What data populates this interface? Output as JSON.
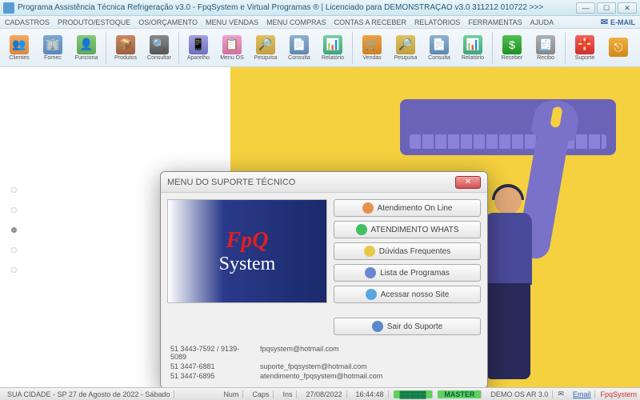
{
  "window": {
    "title": "Programa Assistência Técnica Refrigeração v3.0 - FpqSystem e Virtual Programas ® | Licenciado para  DEMONSTRAÇÃO v3.0 311212 010722 >>>",
    "min": "—",
    "max": "☐",
    "close": "✕"
  },
  "menubar": {
    "items": [
      "CADASTROS",
      "PRODUTO/ESTOQUE",
      "OS/ORÇAMENTO",
      "MENU VENDAS",
      "MENU COMPRAS",
      "CONTAS A RECEBER",
      "RELATÓRIOS",
      "FERRAMENTAS",
      "AJUDA"
    ],
    "email": "E-MAIL"
  },
  "toolbar": [
    {
      "name": "clientes",
      "label": "Clientes",
      "ico": "ico-clientes",
      "glyph": "👥"
    },
    {
      "name": "fornec",
      "label": "Fornec",
      "ico": "ico-fornec",
      "glyph": "🏢"
    },
    {
      "name": "funciona",
      "label": "Funciona",
      "ico": "ico-funcion",
      "glyph": "👤"
    },
    {
      "sep": true
    },
    {
      "name": "produtos",
      "label": "Produtos",
      "ico": "ico-produtos",
      "glyph": "📦"
    },
    {
      "name": "consultar",
      "label": "Consultar",
      "ico": "ico-consultar",
      "glyph": "🔍"
    },
    {
      "sep": true
    },
    {
      "name": "aparelho",
      "label": "Aparelho",
      "ico": "ico-aparelho",
      "glyph": "📱"
    },
    {
      "name": "menuos",
      "label": "Menu OS",
      "ico": "ico-menuos",
      "glyph": "📋"
    },
    {
      "name": "pesquisa",
      "label": "Pesquisa",
      "ico": "ico-pesquisa",
      "glyph": "🔎"
    },
    {
      "name": "consulta",
      "label": "Consulta",
      "ico": "ico-consulta",
      "glyph": "📄"
    },
    {
      "name": "relatorio",
      "label": "Relatório",
      "ico": "ico-relatorio",
      "glyph": "📊"
    },
    {
      "sep": true
    },
    {
      "name": "vendas",
      "label": "Vendas",
      "ico": "ico-vendas",
      "glyph": "🛒"
    },
    {
      "name": "pesquisa2",
      "label": "Pesquisa",
      "ico": "ico-pesquisa",
      "glyph": "🔎"
    },
    {
      "name": "consulta2",
      "label": "Consulta",
      "ico": "ico-consulta",
      "glyph": "📄"
    },
    {
      "name": "relatorio2",
      "label": "Relatório",
      "ico": "ico-relatorio",
      "glyph": "📊"
    },
    {
      "sep": true
    },
    {
      "name": "receber",
      "label": "Receber",
      "ico": "ico-receber",
      "glyph": "$"
    },
    {
      "name": "recibo",
      "label": "Recibo",
      "ico": "ico-recibo",
      "glyph": "🧾"
    },
    {
      "sep": true
    },
    {
      "name": "suporte",
      "label": "Suporte",
      "ico": "ico-suporte",
      "glyph": "🛟"
    },
    {
      "name": "sair",
      "label": "",
      "ico": "ico-sair",
      "glyph": "⎋"
    }
  ],
  "dialog": {
    "title": "MENU DO SUPORTE TÉCNICO",
    "close": "✕",
    "logo": {
      "line1": "FpQ",
      "line2": "System"
    },
    "buttons": [
      {
        "name": "atend-online",
        "label": "Atendimento On Line",
        "ico": "bi-chat"
      },
      {
        "name": "atend-whats",
        "label": "ATENDIMENTO WHATS",
        "ico": "bi-whats"
      },
      {
        "name": "duvidas",
        "label": "Dúvidas Frequentes",
        "ico": "bi-faq"
      },
      {
        "name": "lista-prog",
        "label": "Lista de Programas",
        "ico": "bi-list"
      },
      {
        "name": "site",
        "label": "Acessar nosso Site",
        "ico": "bi-site"
      },
      {
        "name": "sair-suporte",
        "label": "Sair do Suporte",
        "ico": "bi-exit"
      }
    ],
    "contacts": [
      {
        "phone": "51 3443-7592 / 9139-5089",
        "email": "fpqsystem@hotmail.com"
      },
      {
        "phone": "51 3447-6881",
        "email": "suporte_fpqsystem@hotmail.com"
      },
      {
        "phone": "51 3447-6895",
        "email": "atendimento_fpqsystem@hotmail.com"
      }
    ]
  },
  "status": {
    "location": "SUA CIDADE - SP 27 de Agosto de 2022 - Sábado",
    "num": "Num",
    "caps": "Caps",
    "ins": "Ins",
    "date": "27/08/2022",
    "time": "16:44:48",
    "master": "MASTER",
    "demo": "DEMO OS AR 3.0",
    "email": "Email",
    "brand": "FpqSystem"
  }
}
